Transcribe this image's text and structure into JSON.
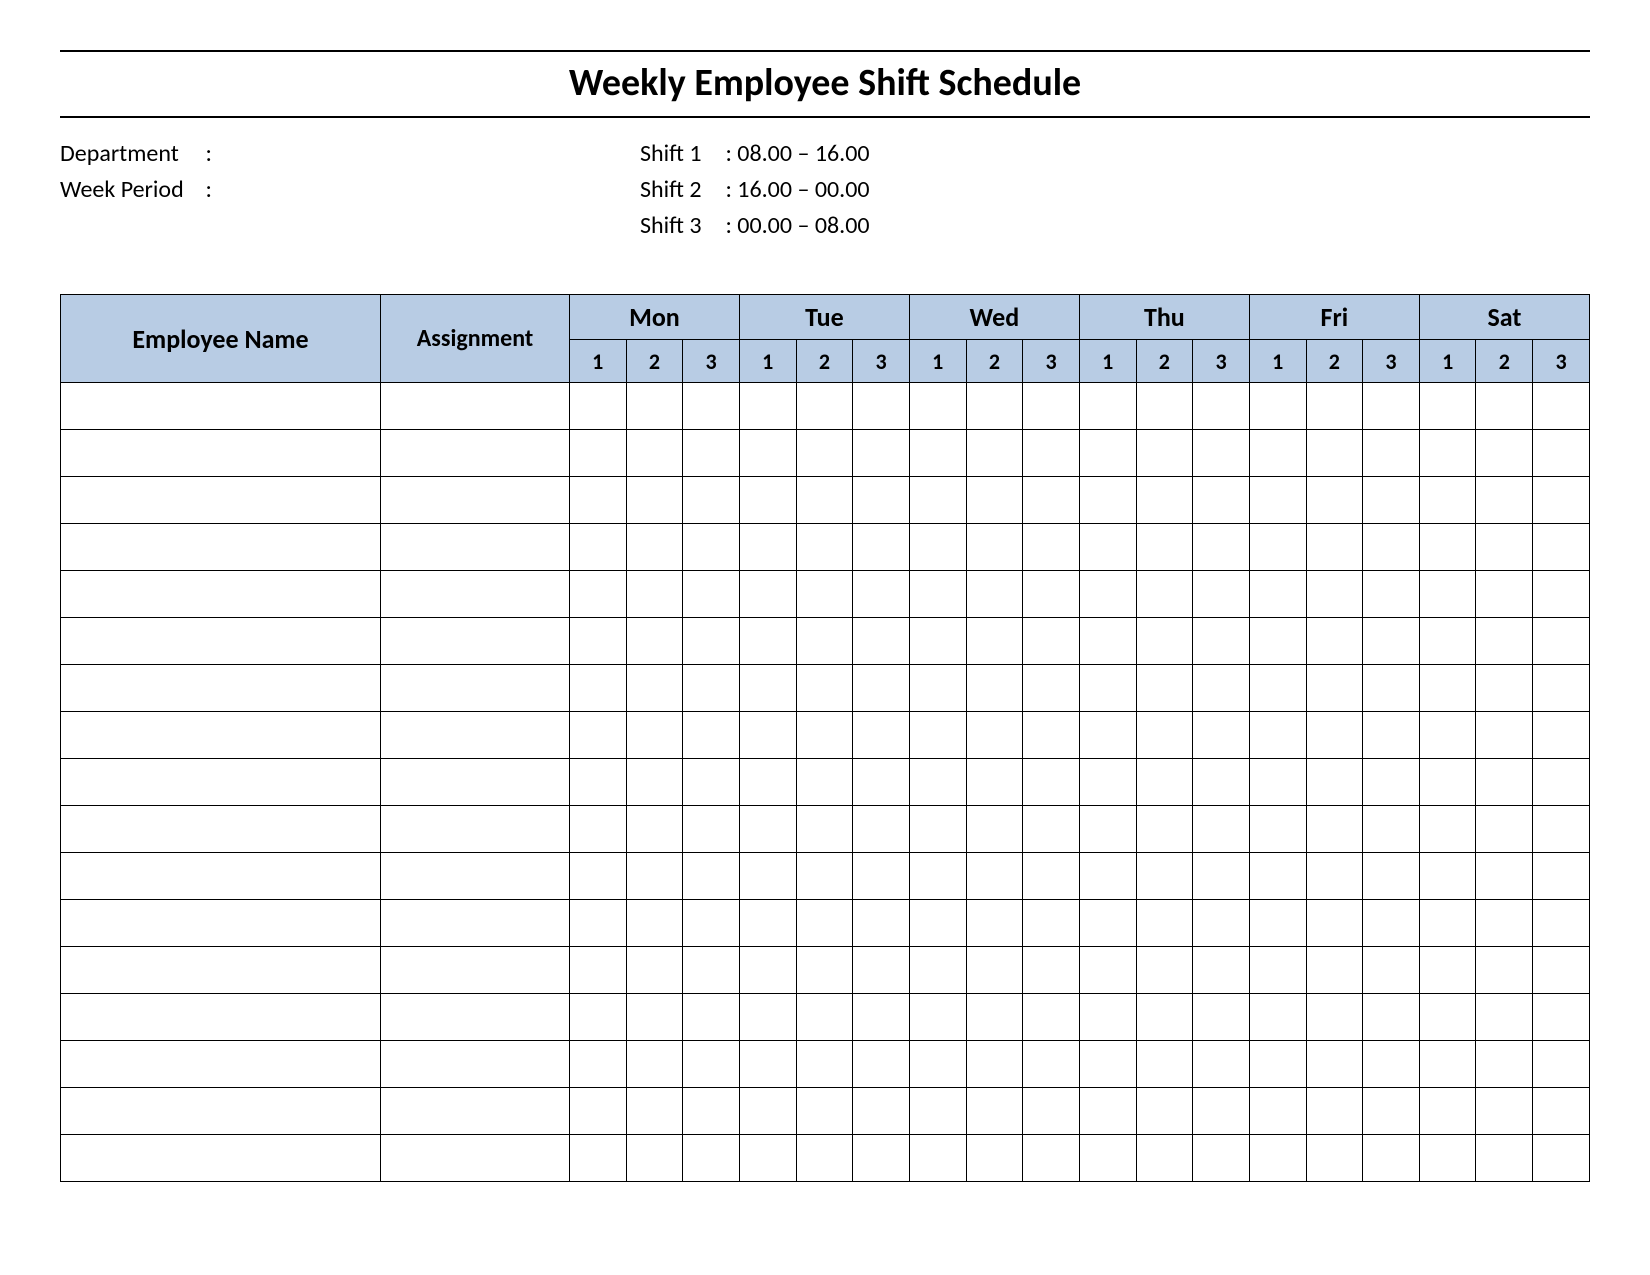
{
  "title": "Weekly Employee Shift Schedule",
  "meta": {
    "department_label": "Department",
    "department_value": "",
    "week_period_label": "Week  Period",
    "week_period_value": "",
    "shifts": [
      {
        "label": "Shift 1",
        "time": "08.00  – 16.00"
      },
      {
        "label": "Shift 2",
        "time": "16.00  – 00.00"
      },
      {
        "label": "Shift 3",
        "time": "00.00  – 08.00"
      }
    ]
  },
  "table": {
    "headers": {
      "employee": "Employee Name",
      "assignment": "Assignment",
      "days": [
        "Mon",
        "Tue",
        "Wed",
        "Thu",
        "Fri",
        "Sat"
      ],
      "shift_numbers": [
        "1",
        "2",
        "3"
      ]
    },
    "row_count": 17
  }
}
